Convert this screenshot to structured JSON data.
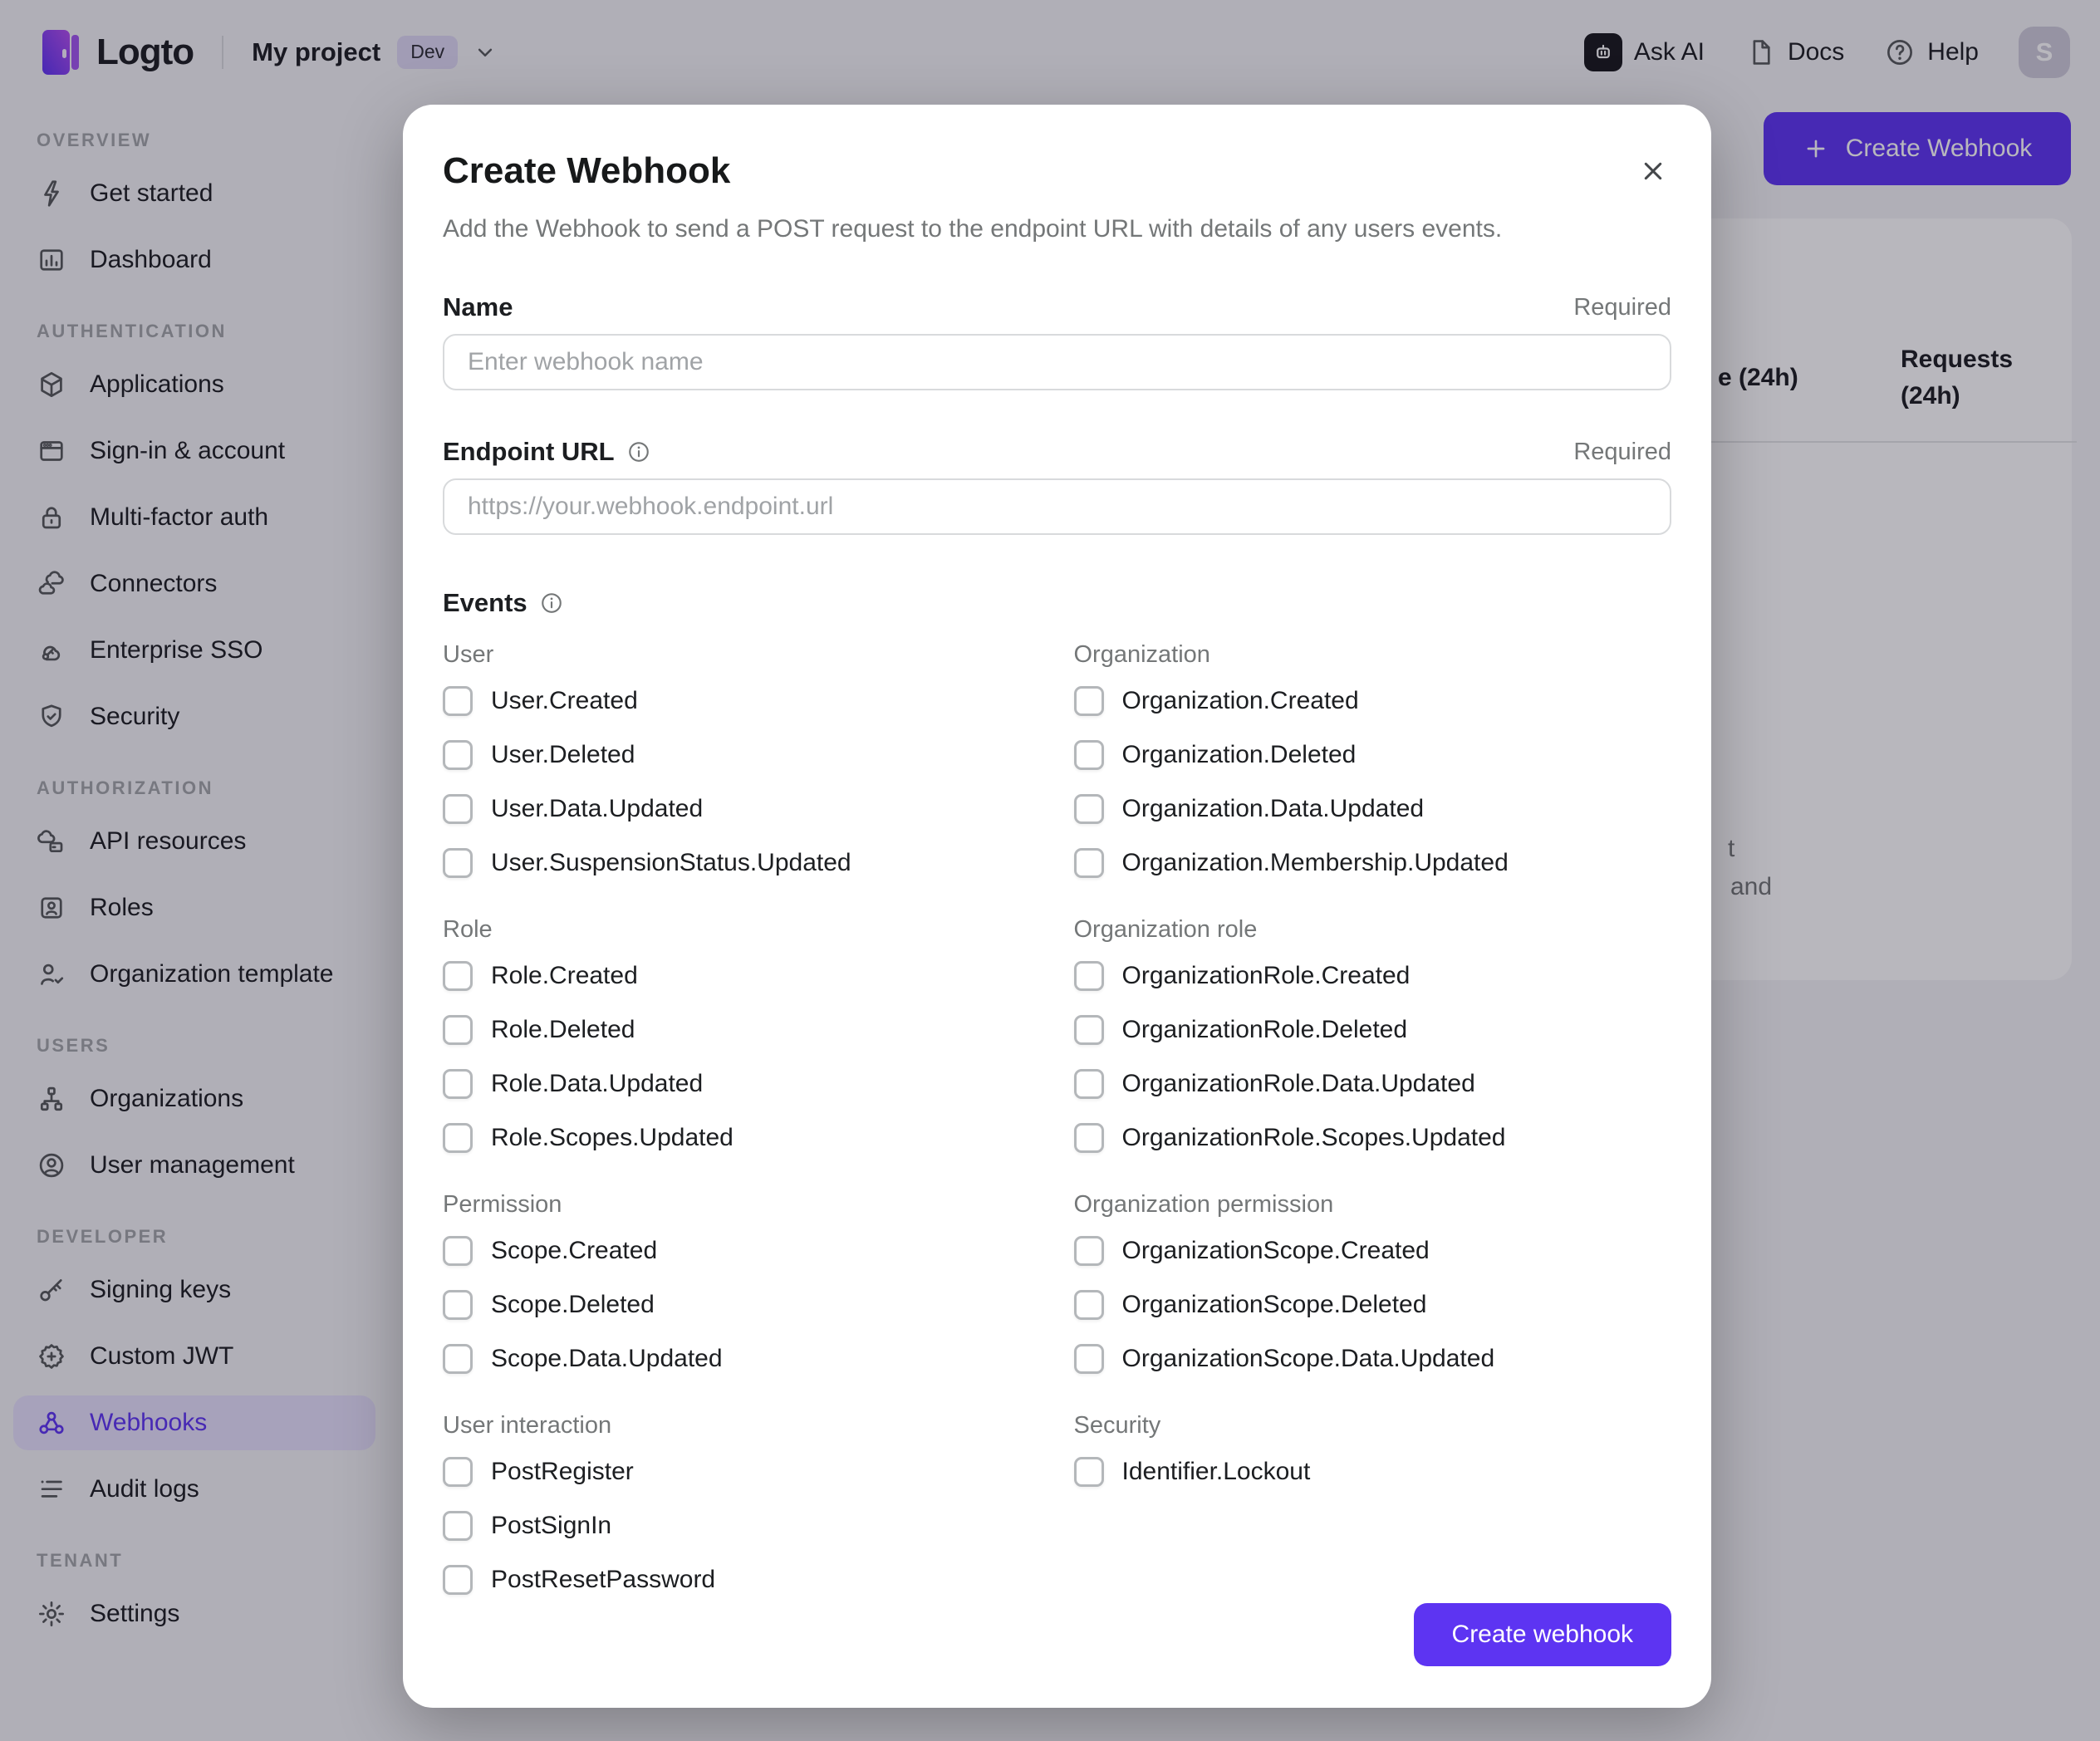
{
  "colors": {
    "accent": "#5d34f2",
    "accent_soft": "#e7e1fd",
    "text_primary": "#1c1e21",
    "text_secondary": "#747778",
    "page_background": "#f4f4f6",
    "surface": "#ffffff",
    "overlay": "rgba(20,16,36,0.30)"
  },
  "topbar": {
    "logo_text": "Logto",
    "project_name": "My project",
    "env_badge": "Dev",
    "ask_ai_label": "Ask AI",
    "docs_label": "Docs",
    "help_label": "Help",
    "avatar_initial": "S"
  },
  "sidebar": {
    "sections": [
      {
        "label": "OVERVIEW",
        "items": [
          {
            "label": "Get started",
            "icon": "lightning-icon"
          },
          {
            "label": "Dashboard",
            "icon": "dashboard-icon"
          }
        ]
      },
      {
        "label": "AUTHENTICATION",
        "items": [
          {
            "label": "Applications",
            "icon": "cube-icon"
          },
          {
            "label": "Sign-in & account",
            "icon": "browser-icon"
          },
          {
            "label": "Multi-factor auth",
            "icon": "lock-icon"
          },
          {
            "label": "Connectors",
            "icon": "connectors-icon"
          },
          {
            "label": "Enterprise SSO",
            "icon": "cloud-key-icon"
          },
          {
            "label": "Security",
            "icon": "shield-check-icon"
          }
        ]
      },
      {
        "label": "AUTHORIZATION",
        "items": [
          {
            "label": "API resources",
            "icon": "cloud-box-icon"
          },
          {
            "label": "Roles",
            "icon": "id-card-icon"
          },
          {
            "label": "Organization template",
            "icon": "person-check-icon"
          }
        ]
      },
      {
        "label": "USERS",
        "items": [
          {
            "label": "Organizations",
            "icon": "org-chart-icon"
          },
          {
            "label": "User management",
            "icon": "person-circle-icon"
          }
        ]
      },
      {
        "label": "DEVELOPER",
        "items": [
          {
            "label": "Signing keys",
            "icon": "key-icon"
          },
          {
            "label": "Custom JWT",
            "icon": "seal-plus-icon"
          },
          {
            "label": "Webhooks",
            "icon": "webhook-icon",
            "active": true
          },
          {
            "label": "Audit logs",
            "icon": "list-icon"
          }
        ]
      },
      {
        "label": "TENANT",
        "items": [
          {
            "label": "Settings",
            "icon": "gear-icon"
          }
        ]
      }
    ]
  },
  "background": {
    "create_button_label": "Create Webhook",
    "table": {
      "col1_header_partial": "e (24h)",
      "col2_header_line1": "Requests",
      "col2_header_line2": "(24h)"
    },
    "clipped_text_fragments": [
      "t",
      "and"
    ]
  },
  "modal": {
    "title": "Create Webhook",
    "description": "Add the Webhook to send a POST request to the endpoint URL with details of any users events.",
    "fields": [
      {
        "label": "Name",
        "required": "Required",
        "placeholder": "Enter webhook name",
        "has_info": false
      },
      {
        "label": "Endpoint URL",
        "required": "Required",
        "placeholder": "https://your.webhook.endpoint.url",
        "has_info": true
      }
    ],
    "events_label": "Events",
    "event_groups": [
      {
        "header": "User",
        "items": [
          "User.Created",
          "User.Deleted",
          "User.Data.Updated",
          "User.SuspensionStatus.Updated"
        ]
      },
      {
        "header": "Organization",
        "items": [
          "Organization.Created",
          "Organization.Deleted",
          "Organization.Data.Updated",
          "Organization.Membership.Updated"
        ]
      },
      {
        "header": "Role",
        "items": [
          "Role.Created",
          "Role.Deleted",
          "Role.Data.Updated",
          "Role.Scopes.Updated"
        ]
      },
      {
        "header": "Organization role",
        "items": [
          "OrganizationRole.Created",
          "OrganizationRole.Deleted",
          "OrganizationRole.Data.Updated",
          "OrganizationRole.Scopes.Updated"
        ]
      },
      {
        "header": "Permission",
        "items": [
          "Scope.Created",
          "Scope.Deleted",
          "Scope.Data.Updated"
        ]
      },
      {
        "header": "Organization permission",
        "items": [
          "OrganizationScope.Created",
          "OrganizationScope.Deleted",
          "OrganizationScope.Data.Updated"
        ]
      },
      {
        "header": "User interaction",
        "items": [
          "PostRegister",
          "PostSignIn",
          "PostResetPassword"
        ]
      },
      {
        "header": "Security",
        "items": [
          "Identifier.Lockout"
        ]
      }
    ],
    "all_checkboxes_checked": false,
    "submit_label": "Create webhook"
  }
}
